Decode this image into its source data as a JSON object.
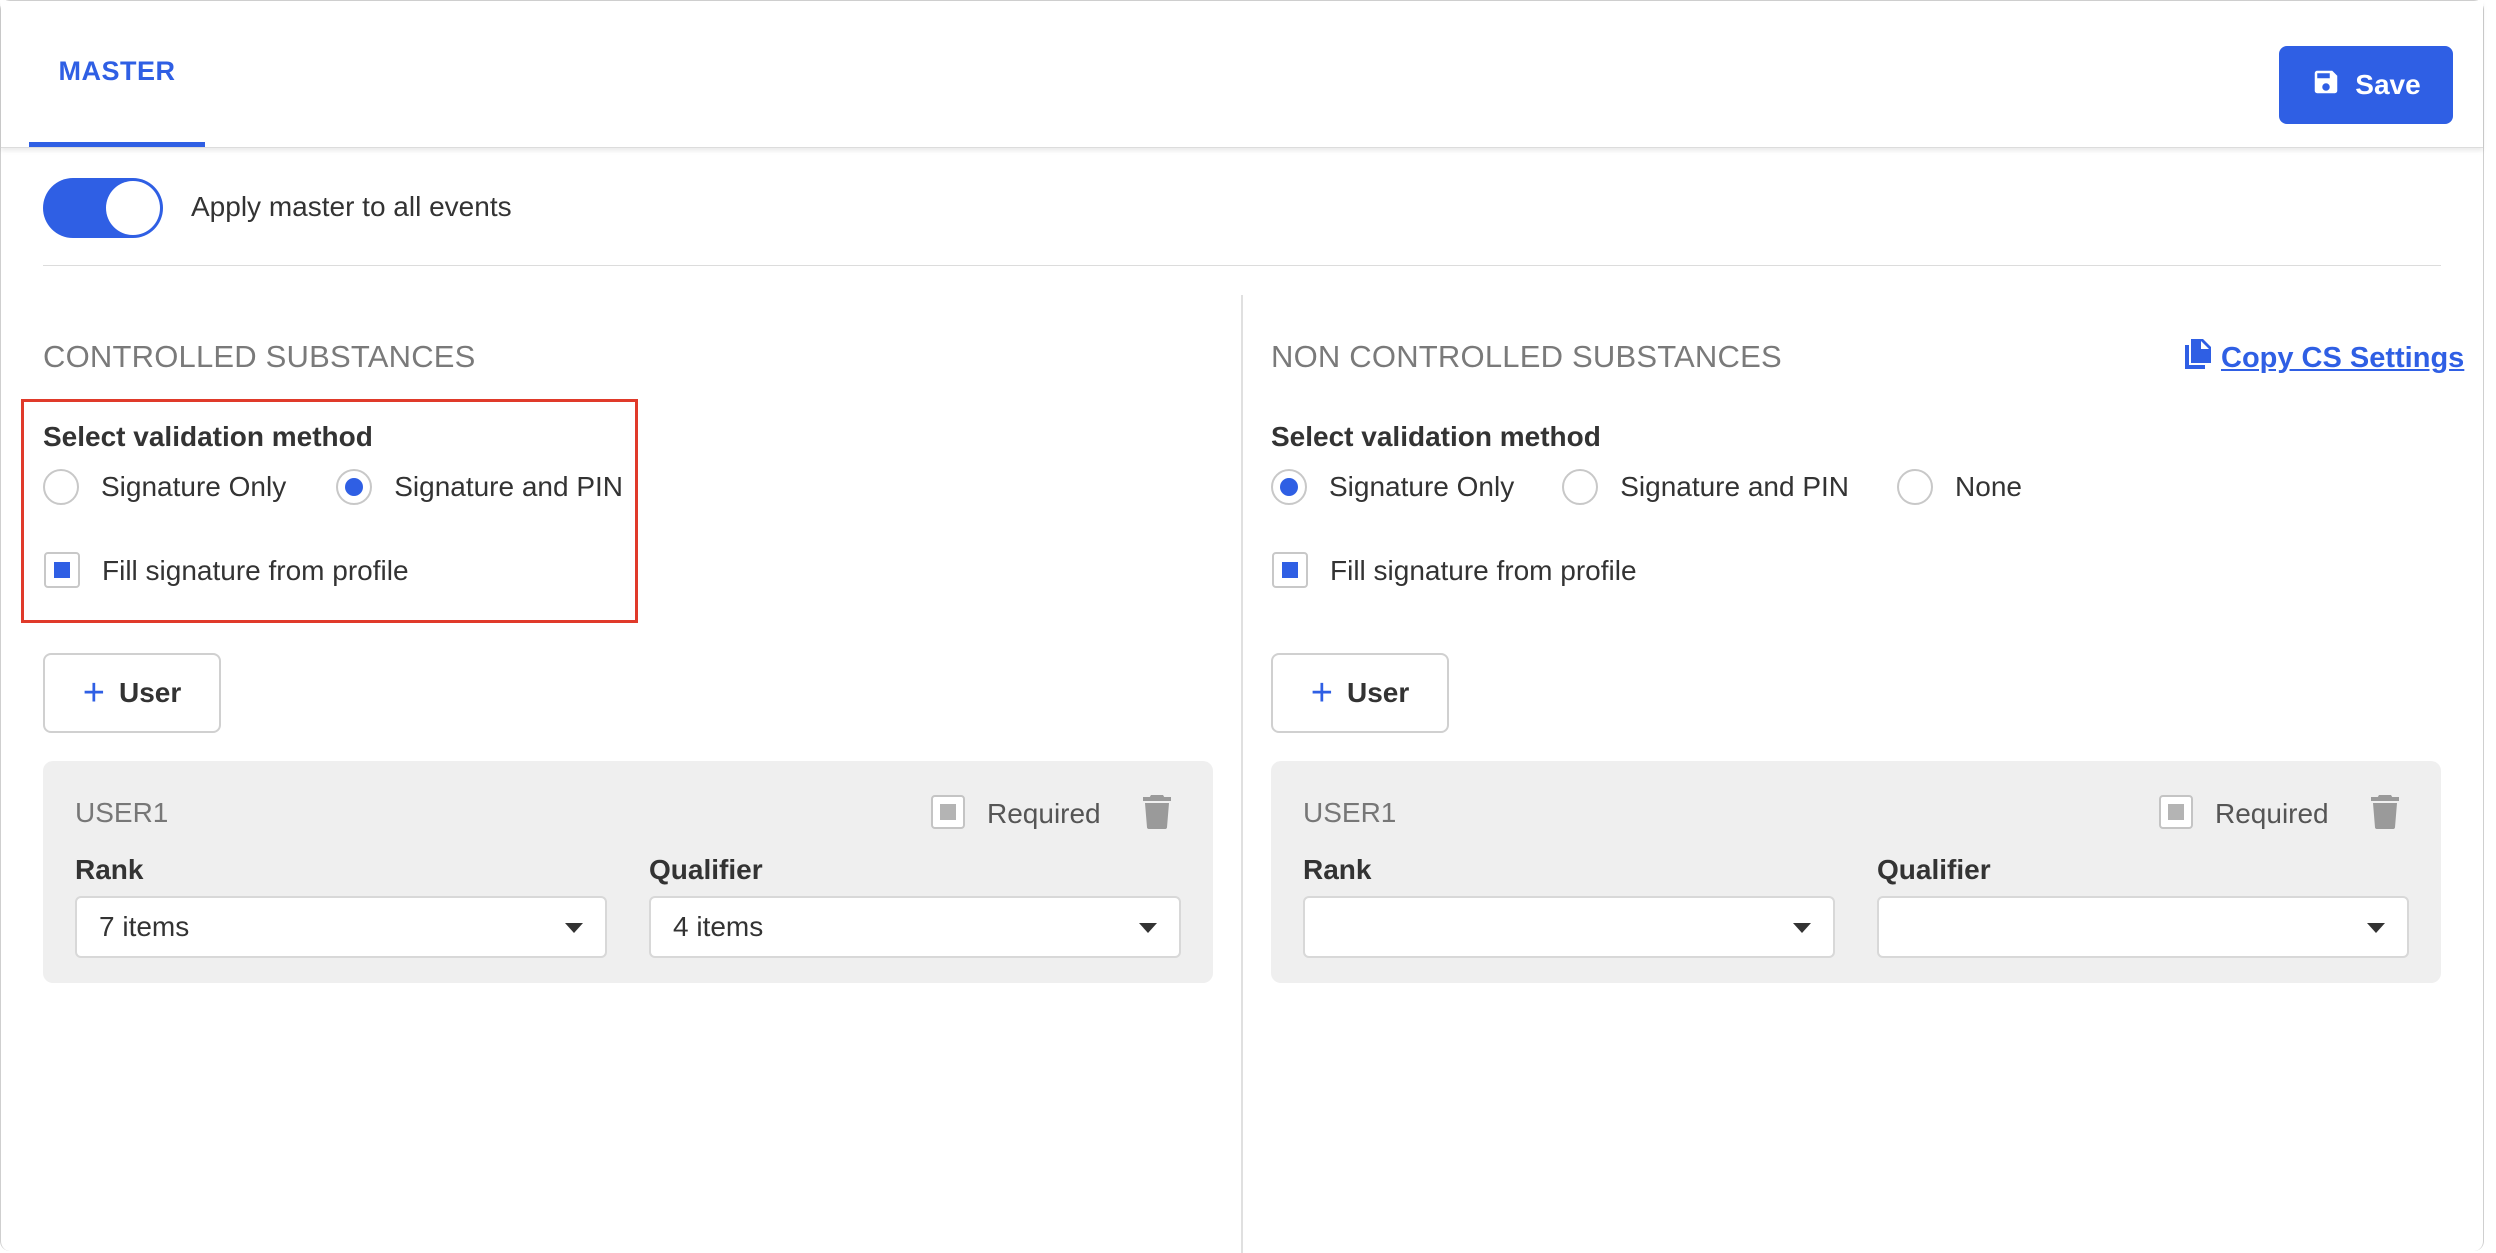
{
  "tabs": [
    {
      "label": "MASTER",
      "active": true
    }
  ],
  "save_label": "Save",
  "apply_master": {
    "label": "Apply master to all events",
    "on": true
  },
  "cs": {
    "title": "CONTROLLED SUBSTANCES",
    "validation_label": "Select validation method",
    "options": [
      "Signature Only",
      "Signature and PIN"
    ],
    "selected": "Signature and PIN",
    "fill_signature_label": "Fill signature from profile",
    "fill_signature_checked": true,
    "add_user_label": "User",
    "user": {
      "name": "USER1",
      "required_label": "Required",
      "rank_label": "Rank",
      "rank_value": "7 items",
      "qualifier_label": "Qualifier",
      "qualifier_value": "4 items"
    }
  },
  "ncs": {
    "title": "NON CONTROLLED SUBSTANCES",
    "copy_label": "Copy CS Settings",
    "validation_label": "Select validation method",
    "options": [
      "Signature Only",
      "Signature and PIN",
      "None"
    ],
    "selected": "Signature Only",
    "fill_signature_label": "Fill signature from profile",
    "fill_signature_checked": true,
    "add_user_label": "User",
    "user": {
      "name": "USER1",
      "required_label": "Required",
      "rank_label": "Rank",
      "rank_value": "",
      "qualifier_label": "Qualifier",
      "qualifier_value": ""
    }
  },
  "colors": {
    "accent": "#2f5fe4",
    "highlight": "#e03a2a",
    "card_bg": "#efefef"
  },
  "icons": [
    "save-icon",
    "plus-icon",
    "trash-icon",
    "copy-icon",
    "caret-down-icon"
  ]
}
